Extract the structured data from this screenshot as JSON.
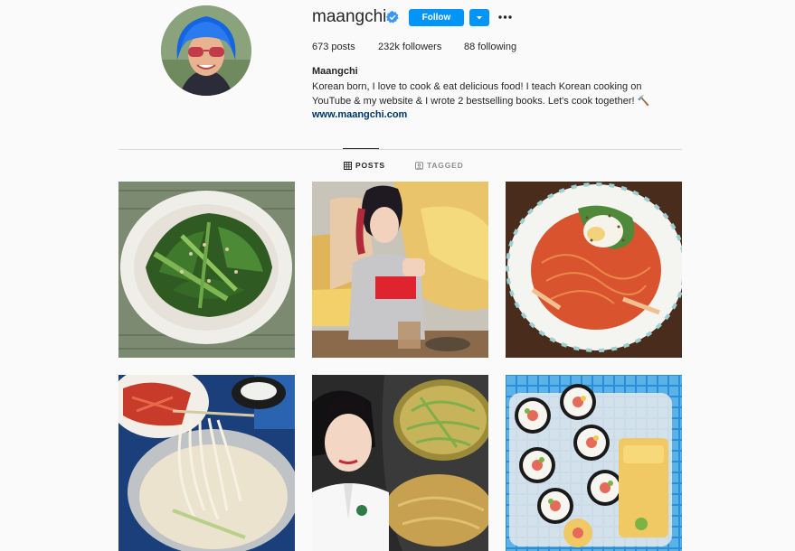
{
  "profile": {
    "username": "maangchi",
    "follow_label": "Follow",
    "stats": {
      "posts": "673 posts",
      "followers": "232k followers",
      "following": "88 following"
    },
    "full_name": "Maangchi",
    "bio": "Korean born, I love to cook & eat delicious food! I teach Korean cooking on YouTube & my website & I wrote 2 bestselling books. Let's cook together! 🔨",
    "website": "www.maangchi.com"
  },
  "tabs": [
    {
      "label": "POSTS",
      "icon": "grid-icon",
      "active": true
    },
    {
      "label": "TAGGED",
      "icon": "tagged-icon",
      "active": false
    }
  ],
  "colors": {
    "accent": "#0095f6",
    "text": "#262626",
    "muted": "#8e8e8e",
    "link": "#00376b",
    "background": "#fafafa",
    "divider": "#dbdbdb"
  },
  "icons": {
    "verified": "verified-badge-icon",
    "dropdown": "chevron-down-icon",
    "more": "more-options-icon"
  },
  "posts": [
    {
      "subject": "seasoned-spinach"
    },
    {
      "subject": "egg-bread"
    },
    {
      "subject": "spicy-noodles"
    },
    {
      "subject": "kongguksu-noodles"
    },
    {
      "subject": "cabbage-pancake"
    },
    {
      "subject": "kimbap-lunchbox"
    }
  ]
}
